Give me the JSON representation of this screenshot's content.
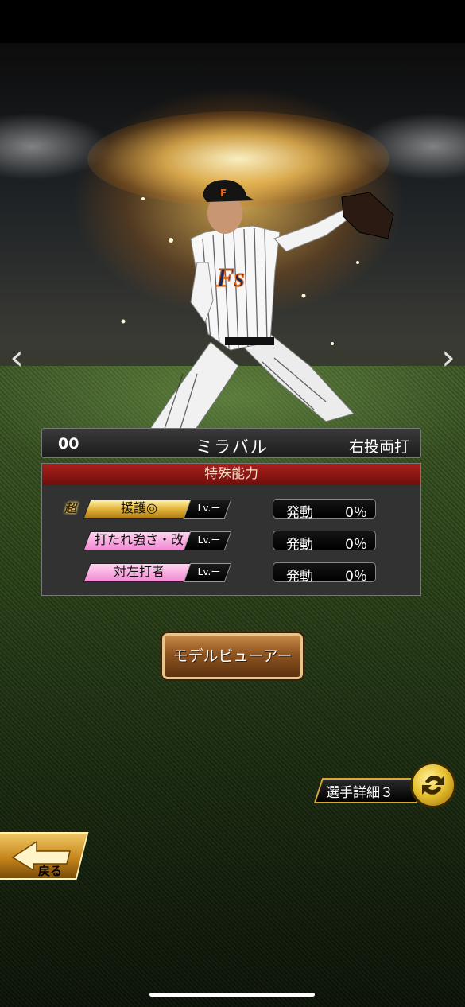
{
  "player": {
    "number": "00",
    "name": "ミラバル",
    "throw_bat": "右投両打",
    "jersey_logo": "Fs"
  },
  "abilities": {
    "title": "特殊能力",
    "items": [
      {
        "name": "援護◎",
        "super": "超",
        "level": "Lv.ー",
        "trigger_label": "発動",
        "trigger_value": "0％",
        "tag_color": "#e2b53b"
      },
      {
        "name": "打たれ強さ・改",
        "super": "",
        "level": "Lv.ー",
        "trigger_label": "発動",
        "trigger_value": "0％",
        "tag_color": "#f28ad3"
      },
      {
        "name": "対左打者",
        "super": "",
        "level": "Lv.ー",
        "trigger_label": "発動",
        "trigger_value": "0％",
        "tag_color": "#f28ad3"
      }
    ]
  },
  "buttons": {
    "model_viewer": "モデルビューアー",
    "player_detail": "選手詳細３",
    "back": "戻る"
  },
  "icons": {
    "prev": "chevron-left-icon",
    "next": "chevron-right-icon",
    "swap": "swap-arrows-icon",
    "back": "back-arrow-icon"
  },
  "colors": {
    "ability_header": "#a8201c",
    "button_gold": "#d9a837",
    "model_button": "#8e5420"
  }
}
